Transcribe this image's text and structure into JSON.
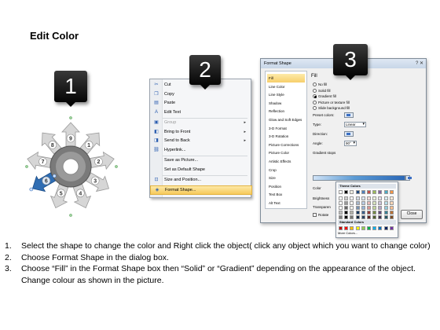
{
  "title": "Edit Color",
  "badges": [
    "1",
    "2",
    "3"
  ],
  "cycle": {
    "labels": [
      "9",
      "1",
      "2",
      "3",
      "4",
      "5",
      "6",
      "7",
      "8"
    ],
    "selected": "6"
  },
  "context_menu": {
    "items": [
      {
        "label": "Cut",
        "icon": "scissors-icon",
        "glyph": "✂"
      },
      {
        "label": "Copy",
        "icon": "copy-icon",
        "glyph": "❐"
      },
      {
        "label": "Paste",
        "icon": "paste-icon",
        "glyph": "▤"
      },
      {
        "label": "Edit Text",
        "icon": "edit-text-icon",
        "glyph": "A"
      },
      {
        "label": "Group",
        "icon": "group-icon",
        "glyph": "▣"
      },
      {
        "label": "Bring to Front",
        "icon": "bring-front-icon",
        "glyph": "◧"
      },
      {
        "label": "Send to Back",
        "icon": "send-back-icon",
        "glyph": "◨"
      },
      {
        "label": "Hyperlink...",
        "icon": "hyperlink-icon",
        "glyph": "⛓"
      },
      {
        "label": "Save as Picture...",
        "icon": "save-picture-icon",
        "glyph": ""
      },
      {
        "label": "Set as Default Shape",
        "icon": "",
        "glyph": ""
      },
      {
        "label": "Size and Position...",
        "icon": "size-position-icon",
        "glyph": "⊡"
      },
      {
        "label": "Format Shape...",
        "icon": "format-shape-icon",
        "glyph": "◈"
      }
    ]
  },
  "dialog": {
    "title": "Format Shape",
    "controls": "? ✕",
    "categories": [
      "Fill",
      "Line Color",
      "Line Style",
      "Shadow",
      "Reflection",
      "Glow and Soft Edges",
      "3-D Format",
      "3-D Rotation",
      "Picture Corrections",
      "Picture Color",
      "Artistic Effects",
      "Crop",
      "Size",
      "Position",
      "Text Box",
      "Alt Text"
    ],
    "fill": {
      "heading": "Fill",
      "options": [
        "No fill",
        "Solid fill",
        "Gradient fill",
        "Picture or texture fill",
        "Slide background fill"
      ],
      "selected_option": "Gradient fill",
      "preset_colors_label": "Preset colors:",
      "type_label": "Type:",
      "type_value": "Linear",
      "direction_label": "Direction:",
      "angle_label": "Angle:",
      "angle_value": "90°",
      "gradient_stops_label": "Gradient stops",
      "color_label": "Color",
      "position_label": "Position:",
      "position_value": "0%",
      "brightness_label": "Brightness",
      "transparency_label": "Transparen",
      "rotate_label": "Rotate",
      "close_label": "Close"
    }
  },
  "color_popup": {
    "theme_header": "Theme Colors",
    "standard_header": "Standard Colors",
    "more_label": "More Colors...",
    "theme_top": [
      "#ffffff",
      "#000000",
      "#eeece1",
      "#1f497d",
      "#4f81bd",
      "#c0504d",
      "#9bbb59",
      "#8064a2",
      "#4bacc6",
      "#f79646"
    ],
    "standard": [
      "#c00000",
      "#ff0000",
      "#ffc000",
      "#ffff00",
      "#92d050",
      "#00b050",
      "#00b0f0",
      "#0070c0",
      "#002060",
      "#7030a0"
    ]
  },
  "instructions": [
    {
      "num": "1.",
      "text": "Select the shape to change the color and Right click the object( click any object which you want to change color)"
    },
    {
      "num": "2.",
      "text": "Choose Format Shape in the dialog box."
    },
    {
      "num": "3.",
      "text": "Choose “Fill” in the Format Shape box then “Solid” or “Gradient” depending on the appearance of the object. Change colour as shown in the picture."
    }
  ]
}
